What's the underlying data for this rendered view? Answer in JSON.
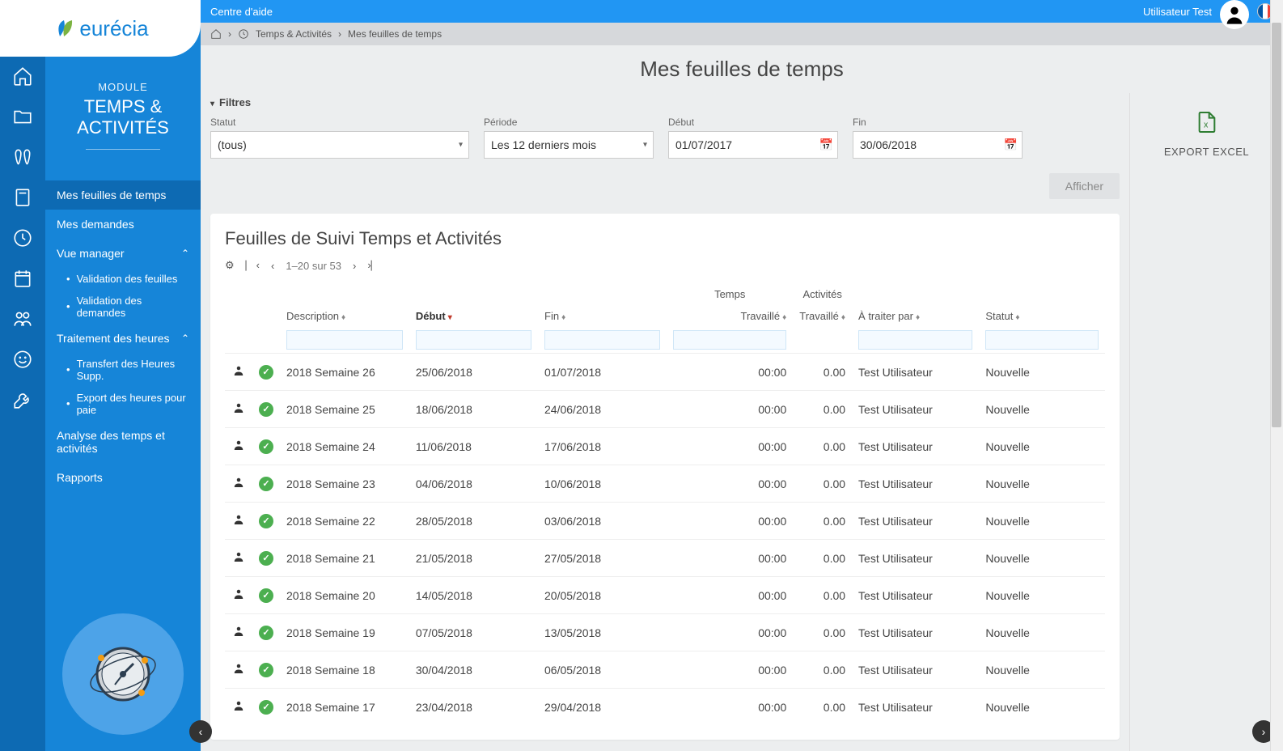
{
  "logo": {
    "text": "eurécia"
  },
  "module": {
    "label": "MODULE",
    "title": "TEMPS & ACTIVITÉS"
  },
  "nav": {
    "items": [
      {
        "label": "Mes feuilles de temps",
        "active": true
      },
      {
        "label": "Mes demandes"
      },
      {
        "label": "Vue manager",
        "expandable": true,
        "expanded": true
      },
      {
        "label": "Traitement des heures",
        "expandable": true,
        "expanded": true
      },
      {
        "label": "Analyse des temps et activités"
      },
      {
        "label": "Rapports"
      }
    ],
    "sub_vue_manager": [
      {
        "label": "Validation des feuilles"
      },
      {
        "label": "Validation des demandes"
      }
    ],
    "sub_traitement": [
      {
        "label": "Transfert des Heures Supp."
      },
      {
        "label": "Export des heures pour paie"
      }
    ]
  },
  "topbar": {
    "help": "Centre d'aide",
    "user": "Utilisateur  Test"
  },
  "breadcrumb": {
    "part1": "Temps & Activités",
    "part2": "Mes feuilles de temps"
  },
  "page_title": "Mes feuilles de temps",
  "filters": {
    "toggle": "Filtres",
    "statut_label": "Statut",
    "statut_value": "(tous)",
    "periode_label": "Période",
    "periode_value": "Les 12 derniers mois",
    "debut_label": "Début",
    "debut_value": "01/07/2017",
    "fin_label": "Fin",
    "fin_value": "30/06/2018",
    "afficher": "Afficher"
  },
  "export": {
    "label": "EXPORT EXCEL"
  },
  "table": {
    "title": "Feuilles de Suivi Temps et Activités",
    "pagination": "1–20 sur 53",
    "headers": {
      "description": "Description",
      "debut": "Début",
      "fin": "Fin",
      "temps_group": "Temps",
      "temps_travaille": "Travaillé",
      "activites_group": "Activités",
      "activites_travaille": "Travaillé",
      "a_traiter": "À traiter par",
      "statut": "Statut"
    },
    "rows": [
      {
        "desc": "2018 Semaine 26",
        "debut": "25/06/2018",
        "fin": "01/07/2018",
        "temps": "00:00",
        "act": "0.00",
        "par": "Test Utilisateur",
        "statut": "Nouvelle"
      },
      {
        "desc": "2018 Semaine 25",
        "debut": "18/06/2018",
        "fin": "24/06/2018",
        "temps": "00:00",
        "act": "0.00",
        "par": "Test Utilisateur",
        "statut": "Nouvelle"
      },
      {
        "desc": "2018 Semaine 24",
        "debut": "11/06/2018",
        "fin": "17/06/2018",
        "temps": "00:00",
        "act": "0.00",
        "par": "Test Utilisateur",
        "statut": "Nouvelle"
      },
      {
        "desc": "2018 Semaine 23",
        "debut": "04/06/2018",
        "fin": "10/06/2018",
        "temps": "00:00",
        "act": "0.00",
        "par": "Test Utilisateur",
        "statut": "Nouvelle"
      },
      {
        "desc": "2018 Semaine 22",
        "debut": "28/05/2018",
        "fin": "03/06/2018",
        "temps": "00:00",
        "act": "0.00",
        "par": "Test Utilisateur",
        "statut": "Nouvelle"
      },
      {
        "desc": "2018 Semaine 21",
        "debut": "21/05/2018",
        "fin": "27/05/2018",
        "temps": "00:00",
        "act": "0.00",
        "par": "Test Utilisateur",
        "statut": "Nouvelle"
      },
      {
        "desc": "2018 Semaine 20",
        "debut": "14/05/2018",
        "fin": "20/05/2018",
        "temps": "00:00",
        "act": "0.00",
        "par": "Test Utilisateur",
        "statut": "Nouvelle"
      },
      {
        "desc": "2018 Semaine 19",
        "debut": "07/05/2018",
        "fin": "13/05/2018",
        "temps": "00:00",
        "act": "0.00",
        "par": "Test Utilisateur",
        "statut": "Nouvelle"
      },
      {
        "desc": "2018 Semaine 18",
        "debut": "30/04/2018",
        "fin": "06/05/2018",
        "temps": "00:00",
        "act": "0.00",
        "par": "Test Utilisateur",
        "statut": "Nouvelle"
      },
      {
        "desc": "2018 Semaine 17",
        "debut": "23/04/2018",
        "fin": "29/04/2018",
        "temps": "00:00",
        "act": "0.00",
        "par": "Test Utilisateur",
        "statut": "Nouvelle"
      }
    ]
  }
}
